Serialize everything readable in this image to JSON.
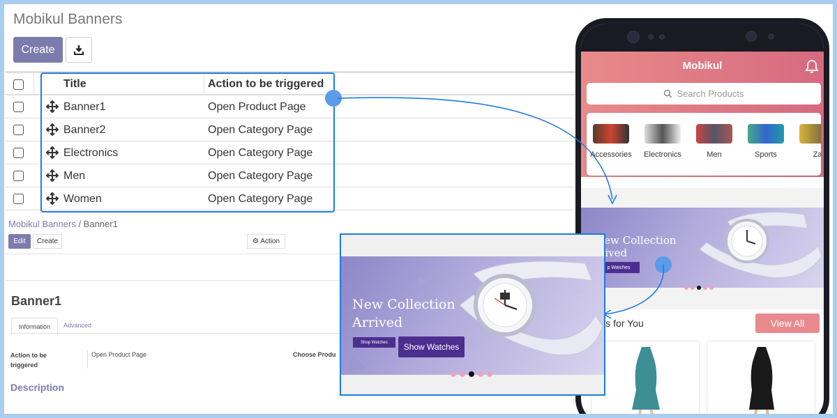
{
  "backend": {
    "page_title": "Mobikul Banners",
    "create_label": "Create",
    "download_icon": "download-icon",
    "list": {
      "headers": {
        "title": "Title",
        "action": "Action to be triggered"
      },
      "rows": [
        {
          "title": "Banner1",
          "action": "Open Product Page"
        },
        {
          "title": "Banner2",
          "action": "Open Category Page"
        },
        {
          "title": "Electronics",
          "action": "Open Category Page"
        },
        {
          "title": "Men",
          "action": "Open Category Page"
        },
        {
          "title": "Women",
          "action": "Open Category Page"
        }
      ]
    },
    "breadcrumb": {
      "parent": "Mobikul Banners",
      "separator": " / ",
      "current": "Banner1"
    },
    "form_buttons": {
      "edit": "Edit",
      "create": "Create",
      "action": "⚙ Action"
    },
    "form": {
      "title": "Banner1",
      "tabs": {
        "information": "Information",
        "advanced": "Advanced"
      },
      "field_label": "Action to be triggered",
      "field_value": "Open Product Page",
      "field_label_2": "Choose Produ",
      "description_label": "Description"
    }
  },
  "popup_banner": {
    "title_line1": "New Collection",
    "title_line2": "Arrived",
    "small_button": "Shop Watches",
    "button": "Show Watches",
    "dots": 5,
    "active_dot": 2
  },
  "phone": {
    "app_title": "Mobikul",
    "bell_icon": "bell-icon",
    "search_placeholder": "Search Products",
    "categories": [
      "Accessories",
      "Electronics",
      "Men",
      "Sports",
      "Za"
    ],
    "banner": {
      "title_line1": "New Collection",
      "title_line2": "rrived",
      "title_prefix": "N",
      "button": "p Watches",
      "active_dot": 2
    },
    "discounts_title": "ounts for You",
    "view_all": "View All"
  },
  "colors": {
    "accent": "#7c7bad",
    "highlight": "#1e7be0",
    "banner_button": "#4b2f8f",
    "view_all": "#e98a8e",
    "header_gradient_start": "#e88a8a",
    "header_gradient_end": "#d66a80",
    "background": "#a9cdf0"
  }
}
